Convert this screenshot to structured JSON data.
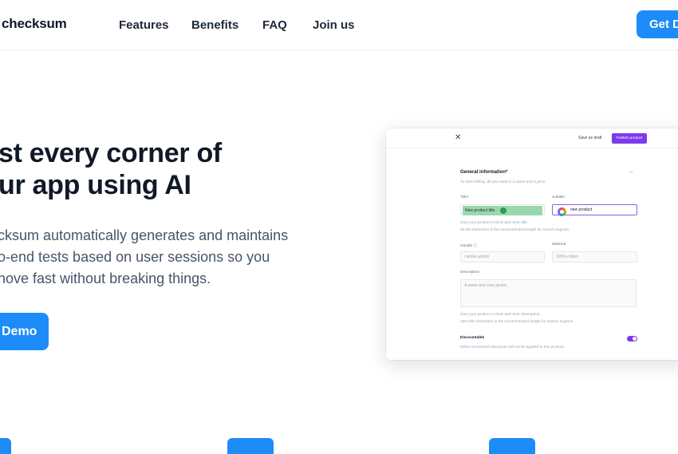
{
  "header": {
    "logo": "checksum",
    "nav": [
      "Features",
      "Benefits",
      "FAQ",
      "Join us"
    ],
    "cta": "Get D"
  },
  "hero": {
    "title_line1": "st every corner of",
    "title_line2": "ur app using AI",
    "subtitle_line1": "cksum automatically generates and maintains",
    "subtitle_line2": "o-end tests based on user sessions so you",
    "subtitle_line3": "nove fast without breaking things.",
    "cta": "Demo"
  },
  "mockup": {
    "close": "✕",
    "save_draft": "Save as draft",
    "publish": "Publish product",
    "section_title": "General information*",
    "section_hint": "To start selling, all you need is a name and a price.",
    "title_label": "Title*",
    "title_value": "New product title",
    "subtitle_label": "Subtitle",
    "subtitle_value": "new product",
    "title_hint_1": "Give your product a short and clear title.",
    "title_hint_2": "50-60 characters is the recommended length for search engines.",
    "handle_label": "Handle ⓘ",
    "handle_placeholder": "/ winter-jacket",
    "material_label": "Material",
    "material_placeholder": "100% cotton",
    "description_label": "Description",
    "description_placeholder": "A warm and cozy jacket...",
    "desc_hint_1": "Give your product a short and clear description.",
    "desc_hint_2": "120-160 characters is the recommended length for search engines.",
    "discountable_label": "Discountable",
    "discountable_hint": "When unchecked discounts will not be applied to this product.",
    "discountable_on": true
  },
  "colors": {
    "primary": "#1d8cf8",
    "accent": "#7c3aed",
    "highlight": "#9ad8ac"
  }
}
